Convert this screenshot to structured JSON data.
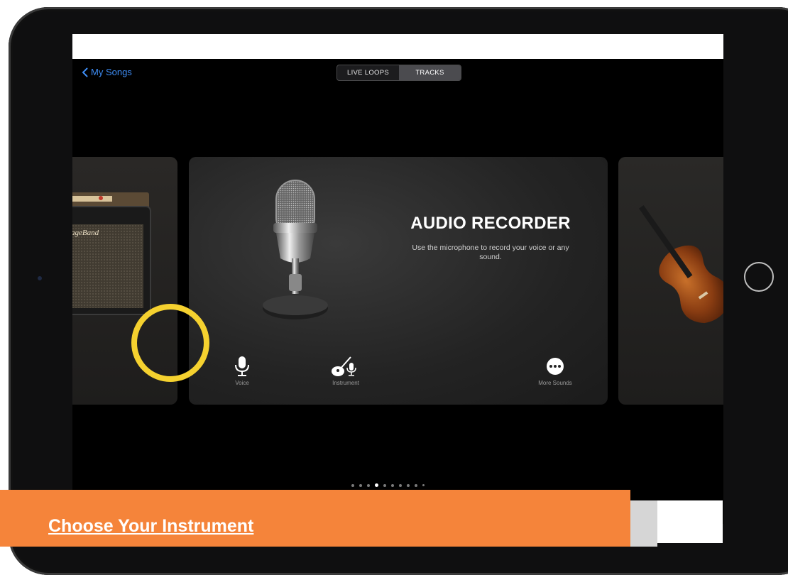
{
  "nav": {
    "back_label": "My Songs"
  },
  "segmented": {
    "options": [
      "LIVE LOOPS",
      "TRACKS"
    ],
    "selected": "TRACKS"
  },
  "card": {
    "title": "AUDIO RECORDER",
    "description": "Use the microphone to record your voice or any sound.",
    "options": [
      {
        "label": "Voice",
        "icon": "microphone-icon"
      },
      {
        "label": "Instrument",
        "icon": "guitar-mic-icon"
      },
      {
        "label": "More Sounds",
        "icon": "more-icon"
      }
    ]
  },
  "side_cards": {
    "left_art": "amplifier-image",
    "left_logo_text": "ageBand",
    "right_art": "violin-image"
  },
  "page_indicator": {
    "count": 10,
    "active_index": 3
  },
  "banner": {
    "title": "Choose Your Instrument"
  },
  "colors": {
    "highlight": "#f5d12f",
    "banner": "#f5843a",
    "link": "#3e8df5"
  }
}
